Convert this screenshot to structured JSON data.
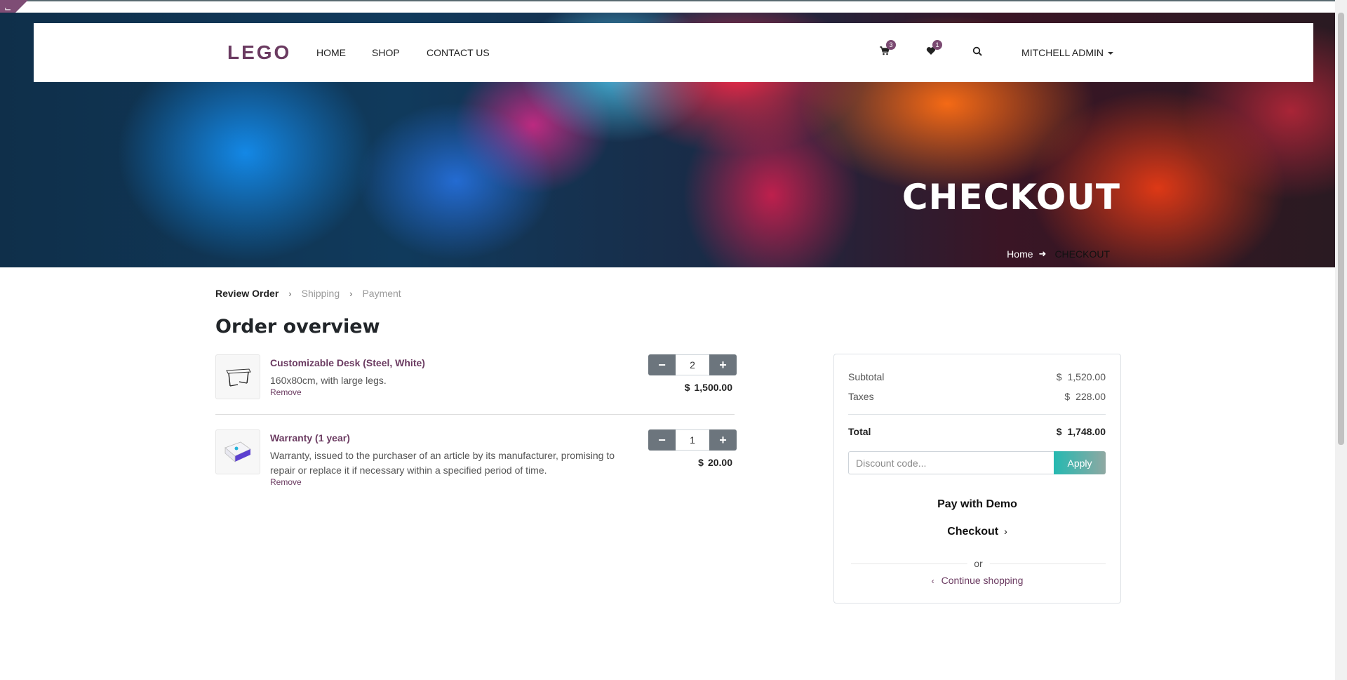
{
  "header": {
    "logo": "LEGO",
    "nav": [
      "HOME",
      "SHOP",
      "CONTACT US"
    ],
    "cart_count": "3",
    "wishlist_count": "1",
    "user": "MITCHELL ADMIN"
  },
  "hero": {
    "title": "CHECKOUT",
    "breadcrumb_home": "Home",
    "breadcrumb_current": "CHECKOUT"
  },
  "steps": [
    "Review Order",
    "Shipping",
    "Payment"
  ],
  "page_title": "Order overview",
  "lines": [
    {
      "name": "Customizable Desk (Steel, White)",
      "description": "160x80cm, with large legs.",
      "remove": "Remove",
      "quantity": "2",
      "currency": "$",
      "price": "1,500.00"
    },
    {
      "name": "Warranty (1 year)",
      "description": "Warranty, issued to the purchaser of an article by its manufacturer, promising to repair or replace it if necessary within a specified period of time.",
      "remove": "Remove",
      "quantity": "1",
      "currency": "$",
      "price": "20.00"
    }
  ],
  "summary": {
    "subtotal_label": "Subtotal",
    "subtotal_currency": "$",
    "subtotal_value": "1,520.00",
    "taxes_label": "Taxes",
    "taxes_currency": "$",
    "taxes_value": "228.00",
    "total_label": "Total",
    "total_currency": "$",
    "total_value": "1,748.00",
    "discount_placeholder": "Discount code...",
    "apply_label": "Apply",
    "pay_with": "Pay with Demo",
    "checkout_label": "Checkout",
    "or_label": "or",
    "continue_label": "Continue shopping"
  },
  "colors": {
    "brand": "#6b3b61",
    "badge": "#7b4a72",
    "qty_button": "#6c757d",
    "apply_gradient_start": "#25b9b1"
  },
  "icons": [
    "cart-icon",
    "heart-icon",
    "search-icon",
    "chevron-right-icon",
    "arrow-right-icon",
    "minus-icon",
    "plus-icon",
    "chevron-left-icon"
  ]
}
